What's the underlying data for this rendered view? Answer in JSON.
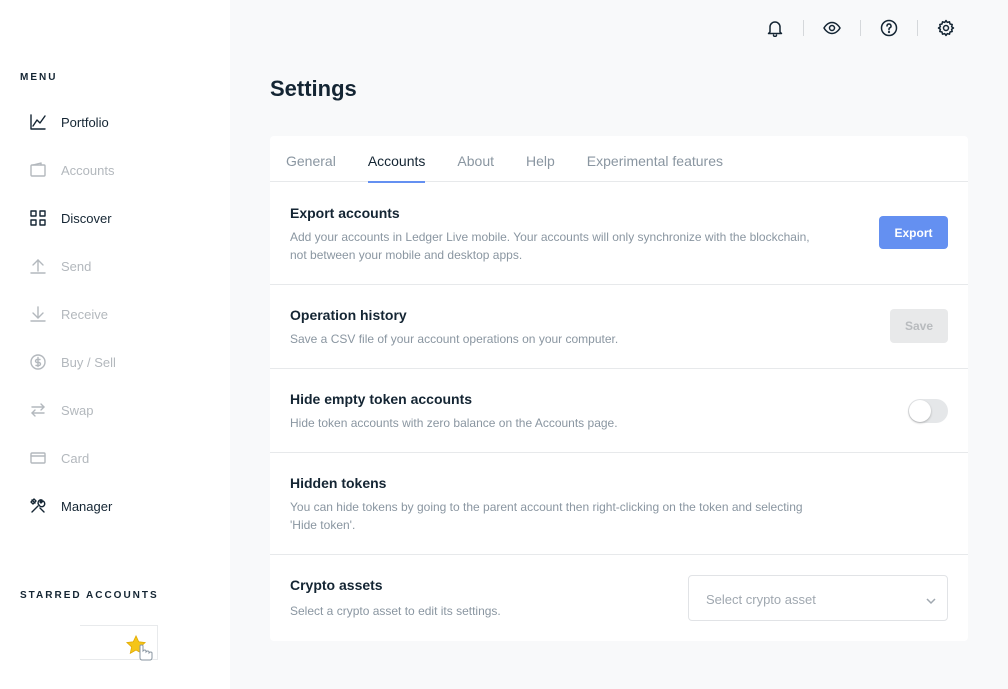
{
  "sidebar": {
    "menu_title": "MENU",
    "items": [
      {
        "label": "Portfolio",
        "icon": "chart-line-icon",
        "active": true
      },
      {
        "label": "Accounts",
        "icon": "wallet-icon",
        "active": false
      },
      {
        "label": "Discover",
        "icon": "grid-icon",
        "active": true
      },
      {
        "label": "Send",
        "icon": "arrow-up-icon",
        "active": false
      },
      {
        "label": "Receive",
        "icon": "arrow-down-icon",
        "active": false
      },
      {
        "label": "Buy / Sell",
        "icon": "dollar-circle-icon",
        "active": false
      },
      {
        "label": "Swap",
        "icon": "swap-icon",
        "active": false
      },
      {
        "label": "Card",
        "icon": "card-icon",
        "active": false
      },
      {
        "label": "Manager",
        "icon": "tools-icon",
        "active": true
      }
    ],
    "starred_title": "STARRED ACCOUNTS"
  },
  "topbar": {
    "icons": [
      "bell-icon",
      "eye-icon",
      "help-icon",
      "gear-icon"
    ]
  },
  "page": {
    "title": "Settings"
  },
  "tabs": [
    {
      "label": "General",
      "active": false
    },
    {
      "label": "Accounts",
      "active": true
    },
    {
      "label": "About",
      "active": false
    },
    {
      "label": "Help",
      "active": false
    },
    {
      "label": "Experimental features",
      "active": false
    }
  ],
  "rows": {
    "export": {
      "title": "Export accounts",
      "desc": "Add your accounts in Ledger Live mobile. Your accounts will only synchronize with the blockchain, not between your mobile and desktop apps.",
      "button": "Export"
    },
    "history": {
      "title": "Operation history",
      "desc": "Save a CSV file of your account operations on your computer.",
      "button": "Save"
    },
    "hide_empty": {
      "title": "Hide empty token accounts",
      "desc": "Hide token accounts with zero balance on the Accounts page.",
      "toggle_on": false
    },
    "hidden_tokens": {
      "title": "Hidden tokens",
      "desc": "You can hide tokens by going to the parent account then right-clicking on the token and selecting 'Hide token'."
    },
    "crypto_assets": {
      "title": "Crypto assets",
      "desc": "Select a crypto asset to edit its settings.",
      "select_placeholder": "Select crypto asset"
    }
  },
  "colors": {
    "accent": "#6490f1",
    "text_primary": "#142533",
    "text_muted": "#8a96a1",
    "star": "#f5c518"
  }
}
